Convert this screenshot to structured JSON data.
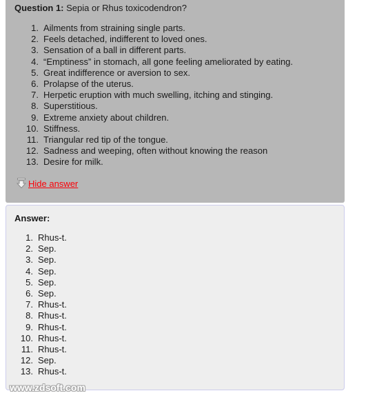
{
  "question_panel": {
    "heading_label": "Question 1:",
    "heading_text": " Sepia or Rhus toxicodendron?",
    "items": [
      "Ailments from straining single parts.",
      "Feels detached, indifferent to loved ones.",
      "Sensation of a ball in different parts.",
      "“Emptiness” in stomach, all gone feeling ameliorated by eating.",
      "Great indifference or aversion to sex.",
      "Prolapse of the uterus.",
      "Herpetic eruption with much swelling, itching and stinging.",
      "Superstitious.",
      "Extreme anxiety about children.",
      "Stiffness.",
      "Triangular red tip of the tongue.",
      "Sadness and weeping, often without knowing the reason",
      "Desire for milk."
    ],
    "numbers": [
      "1.",
      "2.",
      "3.",
      "4.",
      "5.",
      "6.",
      "7.",
      "8.",
      "9.",
      "10.",
      "11.",
      "12.",
      "13."
    ],
    "toggle": {
      "label": "Hide answer",
      "icon": "arrow-down-icon",
      "color": "#fb0007"
    },
    "background_color": "#b7b7b7"
  },
  "answer_panel": {
    "heading": "Answer:",
    "items": [
      "Rhus-t.",
      "Sep.",
      "Sep.",
      "Sep.",
      "Sep.",
      "Sep.",
      "Rhus-t.",
      "Rhus-t.",
      "Rhus-t.",
      "Rhus-t.",
      "Rhus-t.",
      "Sep.",
      "Rhus-t."
    ],
    "numbers": [
      "1.",
      "2.",
      "3.",
      "4.",
      "5.",
      "6.",
      "7.",
      "8.",
      "9.",
      "10.",
      "11.",
      "12.",
      "13."
    ],
    "background_color": "#eeeeee",
    "border_color": "#ccccec"
  },
  "watermark": {
    "text": "www.zdsoft.com"
  }
}
